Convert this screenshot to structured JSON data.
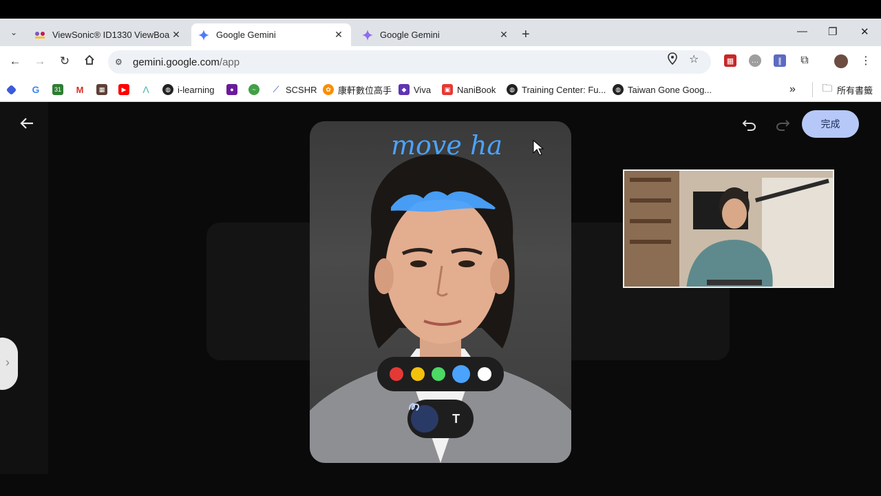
{
  "browser": {
    "tabs": [
      {
        "title": "ViewSonic® ID1330 ViewBoa",
        "active": false
      },
      {
        "title": "Google Gemini",
        "active": true
      },
      {
        "title": "Google Gemini",
        "active": false
      }
    ],
    "new_tab": "+",
    "window_controls": {
      "minimize": "—",
      "restore": "❐",
      "close": "✕"
    },
    "url_host": "gemini.google.com",
    "url_path": "/app",
    "bookmarks": [
      {
        "label": "",
        "icon": "diamond-icon",
        "color": "#3b5bdb"
      },
      {
        "label": "",
        "icon": "google-icon",
        "color": "#4285f4"
      },
      {
        "label": "",
        "icon": "calendar-icon",
        "color": "#2e7d32"
      },
      {
        "label": "",
        "icon": "gmail-icon",
        "color": "#d93025"
      },
      {
        "label": "",
        "icon": "grid-icon",
        "color": "#5d4037"
      },
      {
        "label": "",
        "icon": "youtube-icon",
        "color": "#ff0000"
      },
      {
        "label": "",
        "icon": "a-icon",
        "color": "#4db6ac"
      },
      {
        "label": "i-learning",
        "icon": "globe-icon",
        "color": "#222222"
      },
      {
        "label": "",
        "icon": "people-icon",
        "color": "#6a1b9a"
      },
      {
        "label": "",
        "icon": "leaf-icon",
        "color": "#43a047"
      },
      {
        "label": "SCSHR",
        "icon": "swoosh-icon",
        "color": "#3949ab"
      },
      {
        "label": "康軒數位高手",
        "icon": "flower-icon",
        "color": "#fb8c00"
      },
      {
        "label": "Viva",
        "icon": "gem-icon",
        "color": "#5e35b1"
      },
      {
        "label": "NaniBook",
        "icon": "book-icon",
        "color": "#e53935"
      },
      {
        "label": "Training Center: Fu...",
        "icon": "globe-icon",
        "color": "#222222"
      },
      {
        "label": "Taiwan Gone Goog...",
        "icon": "globe-icon",
        "color": "#222222"
      }
    ],
    "bookmarks_more": "»",
    "all_bookmarks": "所有書籤"
  },
  "editor": {
    "done_label": "完成",
    "handwriting": "move ha",
    "palette": [
      {
        "name": "red",
        "color": "#e53935",
        "selected": false
      },
      {
        "name": "yellow",
        "color": "#f4c20d",
        "selected": false
      },
      {
        "name": "green",
        "color": "#4cd964",
        "selected": false
      },
      {
        "name": "blue",
        "color": "#4aa3ff",
        "selected": true
      },
      {
        "name": "white",
        "color": "#ffffff",
        "selected": false
      }
    ],
    "tools": [
      {
        "name": "draw",
        "glyph": "ઝ",
        "selected": true
      },
      {
        "name": "text",
        "glyph": "T",
        "selected": false
      }
    ]
  }
}
